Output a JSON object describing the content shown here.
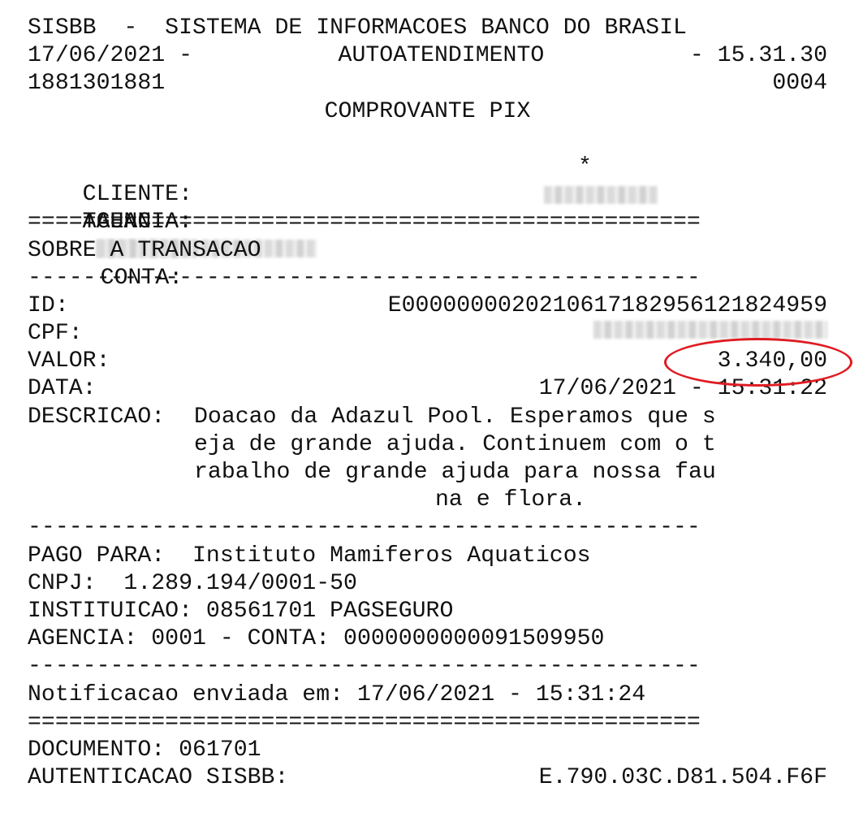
{
  "header": {
    "bank_line": "SISBB  -  SISTEMA DE INFORMACOES BANCO DO BRASIL",
    "date": "17/06/2021 -",
    "service": "AUTOATENDIMENTO",
    "time": "- 15.31.30",
    "code_left": "1881301881",
    "code_right": "0004",
    "title": "COMPROVANTE PIX"
  },
  "client": {
    "label": "CLIENTE:",
    "name": "TAUAN",
    "star": "*",
    "agency_label": "AGENCIA:",
    "account_label": "CONTA:"
  },
  "separators": {
    "double": "=================================================",
    "single": "-------------------------------------------------"
  },
  "transaction": {
    "section_title": "SOBRE A TRANSACAO",
    "id_label": "ID:",
    "id_value": "E00000000202106171829561218249 59",
    "id_value_full": "E0000000020210617182956121824959",
    "cpf_label": "CPF:",
    "valor_label": "VALOR:",
    "valor_value": "3.340,00",
    "data_label": "DATA:",
    "data_value": "17/06/2021 - 15:31:22",
    "descricao_label": "DESCRICAO:",
    "descricao_lines": [
      "Doacao da Adazul Pool. Esperamos que s",
      "eja de grande ajuda. Continuem com o t",
      "rabalho de grande ajuda para nossa fau",
      "na e flora."
    ]
  },
  "payee": {
    "pago_para": "PAGO PARA:  Instituto Mamiferos Aquaticos",
    "cnpj": "CNPJ:  1.289.194/0001-50",
    "instituicao": "INSTITUICAO: 08561701 PAGSEGURO",
    "agencia_conta": "AGENCIA: 0001 - CONTA: 0000000000091509950"
  },
  "notification": "Notificacao enviada em: 17/06/2021 - 15:31:24",
  "footer": {
    "documento": "DOCUMENTO: 061701",
    "autenticacao_label": "AUTENTICACAO SISBB:",
    "autenticacao_value": "E.790.03C.D81.504.F6F"
  },
  "colors": {
    "highlight": "#e01b22"
  }
}
